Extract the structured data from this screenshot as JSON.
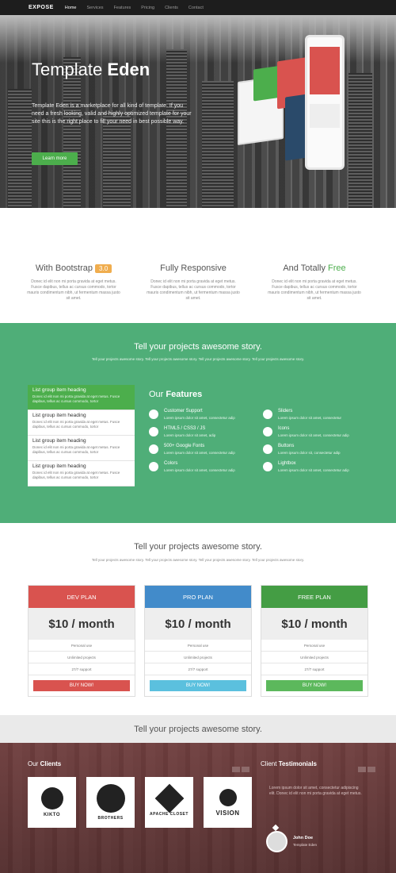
{
  "nav": {
    "brand": "EXPOSE",
    "links": [
      "Home",
      "Services",
      "Features",
      "Pricing",
      "Clients",
      "Contact"
    ]
  },
  "hero": {
    "title_light": "Template",
    "title_bold": "Eden",
    "text": "Template Eden is a marketplace for all kind of template. If you need a fresh looking, valid and highly optimized template for your site this is the right place to fill your need in best possible way.",
    "button": "Learn more"
  },
  "features_row": [
    {
      "title": "With Bootstrap",
      "tag": "3.0",
      "text": "Donec id elit non mi porta gravida at eget metus. Fusce dapibus, tellus ac cursus commodo, tortor mauris condimentum nibh, ut fermentum massa justo sit amet."
    },
    {
      "title": "Fully Responsive",
      "text": "Donec id elit non mi porta gravida at eget metus. Fusce dapibus, tellus ac cursus commodo, tortor mauris condimentum nibh, ut fermentum massa justo sit amet."
    },
    {
      "title": "And Totally",
      "accent": "Free",
      "text": "Donec id elit non mi porta gravida at eget metus. Fusce dapibus, tellus ac cursus commodo, tortor mauris condimentum nibh, ut fermentum massa justo sit amet."
    }
  ],
  "green_band": {
    "title": "Tell your projects awesome story.",
    "subtitle": "Tell your projects awesome story. Tell your projects awesome story. Tell your projects awesome story. Tell your projects awesome story.",
    "list_group": [
      {
        "heading": "List group item heading",
        "text": "Donec id elit non mi porta gravida at eget metus. Fusce dapibus, tellus ac cursus commodo, tortor"
      },
      {
        "heading": "List group item heading",
        "text": "Donec id elit non mi porta gravida at eget metus. Fusce dapibus, tellus ac cursus commodo, tortor"
      },
      {
        "heading": "List group item heading",
        "text": "Donec id elit non mi porta gravida at eget metus. Fusce dapibus, tellus ac cursus commodo, tortor"
      },
      {
        "heading": "List group item heading",
        "text": "Donec id elit non mi porta gravida at eget metus. Fusce dapibus, tellus ac cursus commodo, tortor"
      }
    ],
    "our": "Our",
    "features_word": "Features",
    "features_left": [
      {
        "title": "Customer Support",
        "text": "Lorem ipsum dolor sit amet, consectetur adip"
      },
      {
        "title": "HTML5 / CSS3 / JS",
        "text": "Lorem ipsum dolor sit amet, adip"
      },
      {
        "title": "500+ Google Fonts",
        "text": "Lorem ipsum dolor sit amet, consectetur adip"
      },
      {
        "title": "Colors",
        "text": "Lorem ipsum dolor sit amet, consectetur adip"
      }
    ],
    "features_right": [
      {
        "title": "Sliders",
        "text": "Lorem ipsum dolor sit amet, consectetur"
      },
      {
        "title": "Icons",
        "text": "Lorem ipsum dolor sit amet, consectetur adip"
      },
      {
        "title": "Buttons",
        "text": "Lorem ipsum dolor sit, consectetur adip"
      },
      {
        "title": "Lightbox",
        "text": "Lorem ipsum dolor sit amet, consectetur adip"
      }
    ]
  },
  "pricing": {
    "title": "Tell your projects awesome story.",
    "subtitle": "Tell your projects awesome story. Tell your projects awesome story. Tell your projects awesome story. Tell your projects awesome story.",
    "plans": [
      {
        "name": "DEV PLAN",
        "price": "$10 / month",
        "features": [
          "Personal use",
          "Unlimited projects",
          "27/7 support"
        ],
        "button": "BUY NOW!",
        "header_color": "#d9534f",
        "button_color": "#d9534f"
      },
      {
        "name": "PRO PLAN",
        "price": "$10 / month",
        "features": [
          "Personal use",
          "Unlimited projects",
          "27/7 support"
        ],
        "button": "BUY NOW!",
        "header_color": "#428bca",
        "button_color": "#5bc0de"
      },
      {
        "name": "FREE PLAN",
        "price": "$10 / month",
        "features": [
          "Personal use",
          "Unlimited projects",
          "27/7 support"
        ],
        "button": "BUY NOW!",
        "header_color": "#449d44",
        "button_color": "#5cb85c"
      }
    ]
  },
  "gray_band": {
    "title": "Tell your projects awesome story."
  },
  "clients": {
    "our": "Our",
    "clients_word": "Clients",
    "logos": [
      "KIKTO",
      "BROTHERS",
      "APACHE CLOSET",
      "VISION"
    ],
    "client": "Client",
    "testimonials_word": "Testimonials",
    "testimonial_text": "Lorem ipsum dolor sit amet, consectetur adipiscing elit. Donec id elit non mi porta gravida at eget metus.",
    "author": "John Doe",
    "role": "Template Eden"
  },
  "colors": {
    "accent_green": "#4cae4c",
    "band_green": "#4fae78",
    "warning": "#f0ad4e"
  }
}
